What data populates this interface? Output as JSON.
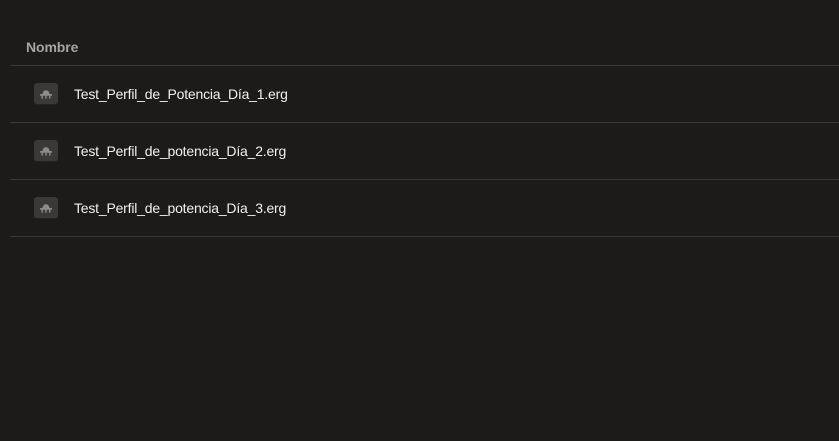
{
  "list": {
    "column_header": "Nombre",
    "files": [
      {
        "name": "Test_Perfil_de_Potencia_Día_1.erg",
        "icon": "erg-workout-icon"
      },
      {
        "name": "Test_Perfil_de_potencia_Día_2.erg",
        "icon": "erg-workout-icon"
      },
      {
        "name": "Test_Perfil_de_potencia_Día_3.erg",
        "icon": "erg-workout-icon"
      }
    ]
  },
  "colors": {
    "background": "#1c1b1a",
    "divider": "#3a3836",
    "header_text": "#a8a4a0",
    "file_text": "#f2f0ee",
    "icon_bg": "#3b3937"
  }
}
